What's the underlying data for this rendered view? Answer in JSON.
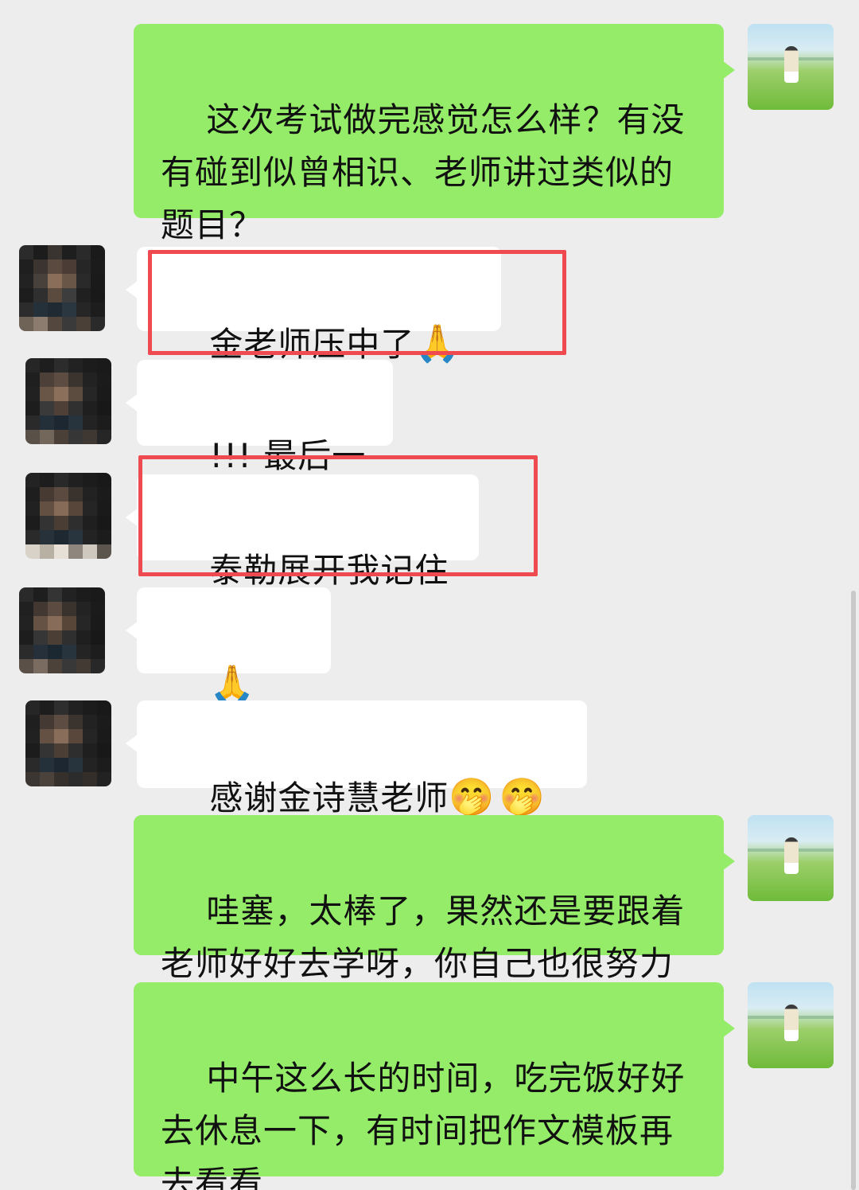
{
  "messages": [
    {
      "sender": "self",
      "text": "这次考试做完感觉怎么样？有没有碰到似曾相识、老师讲过类似的题目？"
    },
    {
      "sender": "other",
      "text": "金老师压中了",
      "emoji": "🙏🙏"
    },
    {
      "sender": "other",
      "text": "!!! 最后一题"
    },
    {
      "sender": "other",
      "text": "泰勒展开我记住了"
    },
    {
      "sender": "other",
      "text": "",
      "emoji": "🙏🙏🙏"
    },
    {
      "sender": "other",
      "text": "感谢金诗慧老师",
      "emoji": "🤭🤭🤭"
    },
    {
      "sender": "self",
      "text": "哇塞，太棒了，果然还是要跟着老师好好去学呀，你自己也很努力"
    },
    {
      "sender": "self",
      "text": "中午这么长的时间，吃完饭好好去休息一下，有时间把作文模板再去看看"
    }
  ],
  "colors": {
    "background": "#ededed",
    "self_bubble": "#95ec69",
    "other_bubble": "#ffffff",
    "highlight": "#ef4a4f"
  },
  "icons": {
    "self_avatar": "grassland-figure-avatar",
    "other_avatar": "pixelated-avatar"
  }
}
